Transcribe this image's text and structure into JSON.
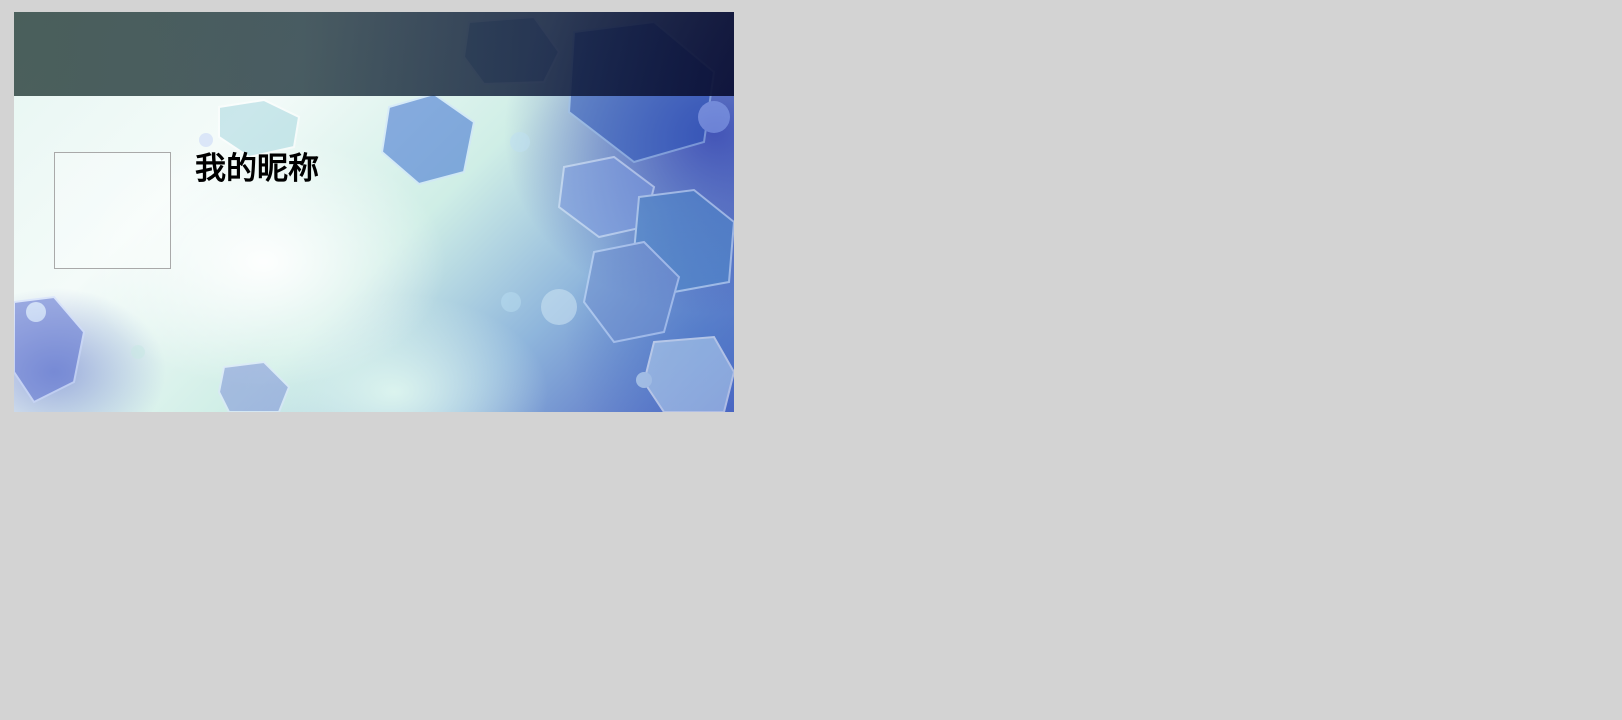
{
  "profile": {
    "nickname": "我的昵称"
  },
  "icons": {
    "avatar": "avatar-placeholder"
  },
  "colors": {
    "page_background": "#d3d3d3",
    "header_band": "#1e343c",
    "avatar_border": "#a9a9a9",
    "nickname_text": "#000000"
  }
}
